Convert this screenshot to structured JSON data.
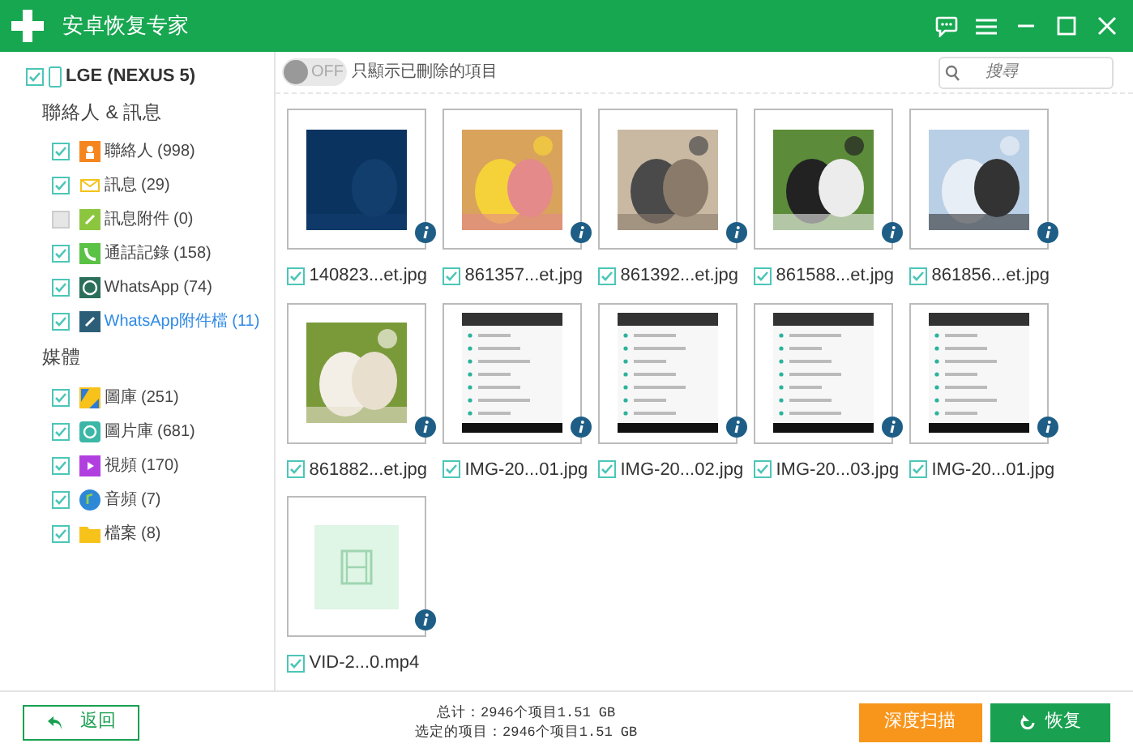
{
  "window": {
    "title": "安卓恢复专家"
  },
  "device": {
    "label": "LGE (NEXUS 5)",
    "checked": true
  },
  "groups": [
    {
      "title": "聯絡人 & 訊息",
      "items": [
        {
          "label": "聯絡人 (998)",
          "checked": true,
          "selected": false
        },
        {
          "label": "訊息 (29)",
          "checked": true,
          "selected": false
        },
        {
          "label": "訊息附件 (0)",
          "checked": false,
          "selected": false
        },
        {
          "label": "通話記錄 (158)",
          "checked": true,
          "selected": false
        },
        {
          "label": "WhatsApp (74)",
          "checked": true,
          "selected": false
        },
        {
          "label": "WhatsApp附件檔 (11)",
          "checked": true,
          "selected": true
        }
      ]
    },
    {
      "title": "媒體",
      "items": [
        {
          "label": "圖庫 (251)",
          "checked": true,
          "selected": false
        },
        {
          "label": "圖片庫 (681)",
          "checked": true,
          "selected": false
        },
        {
          "label": "視頻 (170)",
          "checked": true,
          "selected": false
        },
        {
          "label": "音頻 (7)",
          "checked": true,
          "selected": false
        },
        {
          "label": "檔案 (8)",
          "checked": true,
          "selected": false
        }
      ]
    }
  ],
  "filter": {
    "on": false,
    "switch_text": "OFF",
    "label": "只顯示已刪除的項目"
  },
  "search": {
    "placeholder": "搜尋"
  },
  "files": [
    {
      "name": "140823...et.jpg",
      "checked": true
    },
    {
      "name": "861357...et.jpg",
      "checked": true
    },
    {
      "name": "861392...et.jpg",
      "checked": true
    },
    {
      "name": "861588...et.jpg",
      "checked": true
    },
    {
      "name": "861856...et.jpg",
      "checked": true
    },
    {
      "name": "861882...et.jpg",
      "checked": true
    },
    {
      "name": "IMG-20...01.jpg",
      "kind": "screenshot",
      "checked": true
    },
    {
      "name": "IMG-20...02.jpg",
      "kind": "screenshot",
      "checked": true
    },
    {
      "name": "IMG-20...03.jpg",
      "kind": "screenshot",
      "checked": true
    },
    {
      "name": "IMG-20...01.jpg",
      "kind": "screenshot",
      "checked": true
    },
    {
      "name": "VID-2...0.mp4",
      "kind": "video",
      "checked": true
    }
  ],
  "footer": {
    "back": "返回",
    "total": "总计：2946个项目1.51 GB",
    "selected_total": "选定的项目：2946个项目1.51 GB",
    "deep_scan": "深度扫描",
    "recover": "恢复"
  }
}
